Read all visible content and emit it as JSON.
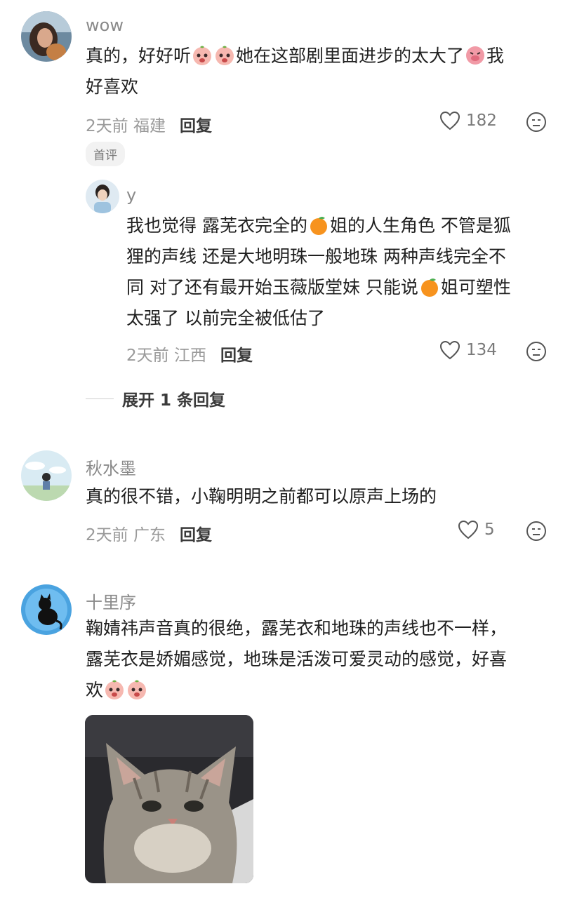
{
  "comments": [
    {
      "username": "wow",
      "text_parts": [
        "真的，好好听",
        "她在这部剧里面进步的太大了",
        "我",
        "好喜欢"
      ],
      "time": "2天前",
      "location": "福建",
      "reply_label": "回复",
      "likes": "182",
      "badge": "首评",
      "reply": {
        "username": "y",
        "text_parts": [
          "我也觉得 露芜衣完全的",
          "姐的人生角色 不管是狐",
          "狸的声线 还是大地明珠一般地珠 两种声线完全不",
          "同 对了还有最开始玉薇版堂妹 只能说",
          "姐可塑性",
          "太强了 以前完全被低估了"
        ],
        "time": "2天前",
        "location": "江西",
        "reply_label": "回复",
        "likes": "134"
      },
      "expand_label": "展开 1 条回复"
    },
    {
      "username": "秋水墨",
      "text": "真的很不错，小鞠明明之前都可以原声上场的",
      "time": "2天前",
      "location": "广东",
      "reply_label": "回复",
      "likes": "5"
    },
    {
      "username": "十里序",
      "text_lines": [
        "鞠婧祎声音真的很绝，露芜衣和地珠的声线也不一样，",
        "露芜衣是娇媚感觉，地珠是活泼可爱灵动的感觉，好喜"
      ],
      "text_last": "欢",
      "image_icon": "cat-photo"
    }
  ],
  "icons": {
    "like": "heart-icon",
    "dislike": "dislike-face-icon",
    "emoji_peach": "crying-peach-emoji",
    "emoji_orange": "orange-emoji",
    "emoji_pig": "pig-emoji"
  },
  "colors": {
    "orange": "#f7931e",
    "peach": "#f4a3a3",
    "text": "#202020",
    "muted": "#9a9a9a"
  }
}
